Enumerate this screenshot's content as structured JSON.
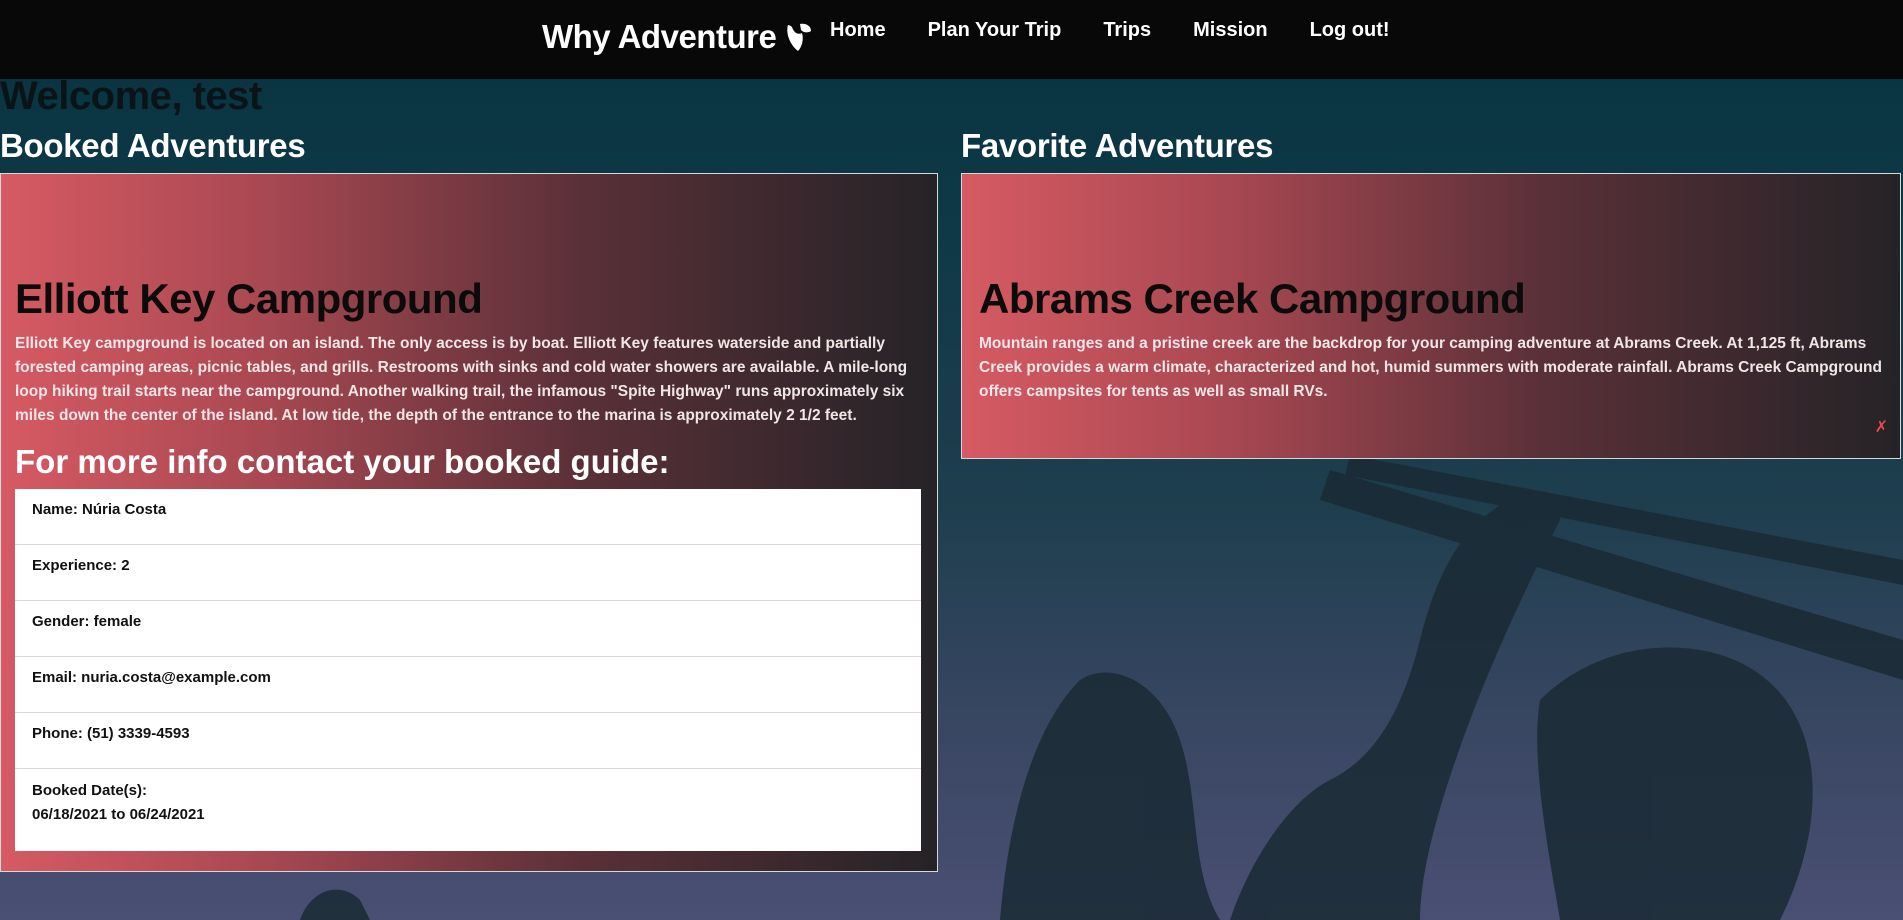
{
  "brand": {
    "name": "Why Adventure",
    "logo_icon": "brand-logo-icon"
  },
  "nav": {
    "items": [
      {
        "label": "Home"
      },
      {
        "label": "Plan Your Trip"
      },
      {
        "label": "Trips"
      },
      {
        "label": "Mission"
      },
      {
        "label": "Log out!"
      }
    ]
  },
  "welcome": "Welcome, test",
  "booked": {
    "heading": "Booked Adventures",
    "title": "Elliott Key Campground",
    "description": "Elliott Key campground is located on an island. The only access is by boat. Elliott Key features waterside and partially forested camping areas, picnic tables, and grills. Restrooms with sinks and cold water showers are available. A mile-long loop hiking trail starts near the campground. Another walking trail, the infamous \"Spite Highway\" runs approximately six miles down the center of the island. At low tide, the depth of the entrance to the marina is approximately 2 1/2 feet.",
    "guide_heading": "For more info contact your booked guide:",
    "guide": {
      "name": "Name: Núria Costa",
      "experience": "Experience: 2",
      "gender": "Gender: female",
      "email": "Email: nuria.costa@example.com",
      "phone": "Phone: (51) 3339-4593",
      "dates_label": "Booked Date(s):",
      "dates": "06/18/2021 to 06/24/2021"
    }
  },
  "favorite": {
    "heading": "Favorite Adventures",
    "title": "Abrams Creek Campground",
    "description": "Mountain ranges and a pristine creek are the backdrop for your camping adventure at Abrams Creek. At 1,125 ft, Abrams Creek provides a warm climate, characterized and hot, humid summers with moderate rainfall. Abrams Creek Campground offers campsites for tents as well as small RVs.",
    "remove_label": "✗"
  },
  "colors": {
    "nav_bg": "#080808",
    "card_gradient_start": "#d65a63",
    "card_gradient_end": "#252327",
    "remove": "#e84855"
  }
}
